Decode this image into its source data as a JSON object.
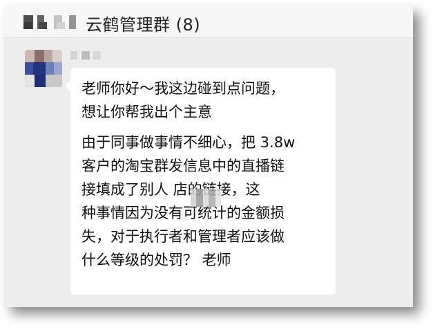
{
  "header": {
    "title": "云鹤管理群 (8)"
  },
  "message": {
    "lines": [
      "老师你好～我这边碰到点问题，",
      "想让你帮我出个主意",
      "由于同事做事情不细心，把 3.8w",
      "客户的淘宝群发信息中的直播链",
      "接填成了别人   店的链接，这",
      "种事情因为没有可统计的金额损",
      "失，对于执行者和管理者应该做",
      "什么等级的处罚？ 老师"
    ]
  }
}
